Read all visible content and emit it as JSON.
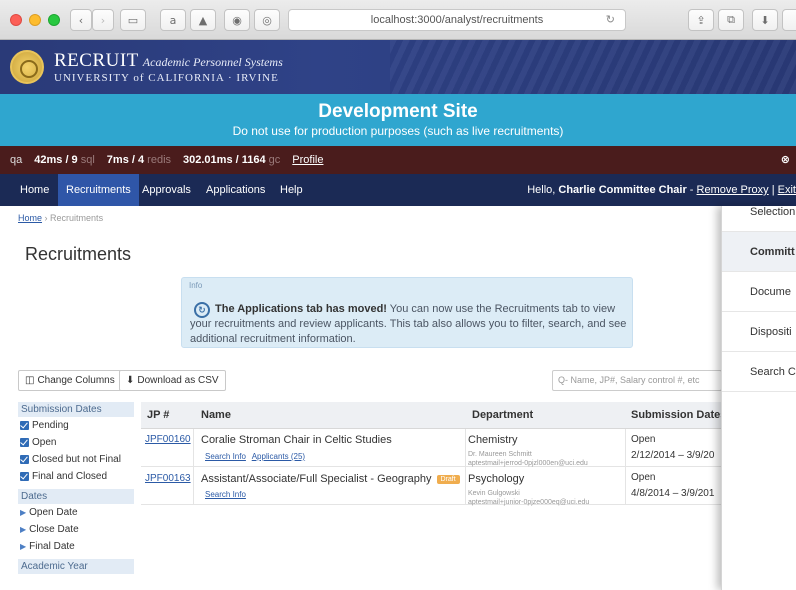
{
  "browser": {
    "url": "localhost:3000/analyst/recruitments",
    "sidebar_icon": "sidebar-icon",
    "reload_icon": "reload-icon"
  },
  "header": {
    "brand_main": "RECRUIT",
    "brand_sub": "Academic Personnel Systems",
    "university": "UNIVERSITY of CALIFORNIA · IRVINE"
  },
  "dev_banner": {
    "title": "Development Site",
    "subtitle": "Do not use for production purposes (such as live recruitments)"
  },
  "profiler": {
    "env": "qa",
    "sql_time": "42ms / 9",
    "sql_label": "sql",
    "redis_time": "7ms / 4",
    "redis_label": "redis",
    "gc_time": "302.01ms / 1164",
    "gc_label": "gc",
    "profile_link": "Profile",
    "close": "⊗"
  },
  "nav": {
    "items": [
      "Home",
      "Recruitments",
      "Approvals",
      "Applications",
      "Help"
    ],
    "active": "Recruitments",
    "hello": "Hello,",
    "user": "Charlie Committee Chair",
    "remove_proxy": "Remove Proxy",
    "exit": "Exit"
  },
  "breadcrumb": {
    "home": "Home",
    "sep": "›",
    "current": "Recruitments"
  },
  "page": {
    "title": "Recruitments"
  },
  "info": {
    "label": "Info",
    "bold": "The Applications tab has moved!",
    "text": " You can now use the Recruitments tab to view your recruitments and review applicants. This tab also allows you to filter, search, and see additional recruitment information."
  },
  "toolbar": {
    "change_columns": "Change Columns",
    "download_csv": "Download as CSV",
    "search_placeholder": "Q- Name, JP#, Salary control #, etc"
  },
  "filters": {
    "submission_dates_label": "Submission Dates",
    "statuses": [
      "Pending",
      "Open",
      "Closed but not Final",
      "Final and Closed"
    ],
    "dates_label": "Dates",
    "date_options": [
      "Open Date",
      "Close Date",
      "Final Date"
    ],
    "academic_year_label": "Academic Year"
  },
  "table": {
    "columns": [
      "JP #",
      "Name",
      "Department",
      "Submission Dates"
    ],
    "rows": [
      {
        "jp": "JPF00160",
        "name": "Coralie Stroman Chair in Celtic Studies",
        "links": [
          "Search Info",
          "Applicants (25)"
        ],
        "badge": "",
        "department": "Chemistry",
        "contact_name": "Dr. Maureen Schmitt",
        "contact_email": "aptestmail+jerrod-0pjzl000en@uci.edu",
        "status": "Open",
        "dates": "2/12/2014 – 3/9/20"
      },
      {
        "jp": "JPF00163",
        "name": "Assistant/Associate/Full Specialist - Geography",
        "links": [
          "Search Info"
        ],
        "badge": "Draft",
        "department": "Psychology",
        "contact_name": "Kevin Gulgowski",
        "contact_email": "aptestmail+junior-0pjze000eq@uci.edu",
        "status": "Open",
        "dates": "4/8/2014 – 3/9/201"
      }
    ]
  },
  "side_panel": {
    "items": [
      "Selection",
      "Committ",
      "Docume",
      "Dispositi",
      "Search C"
    ],
    "active": "Committ"
  }
}
